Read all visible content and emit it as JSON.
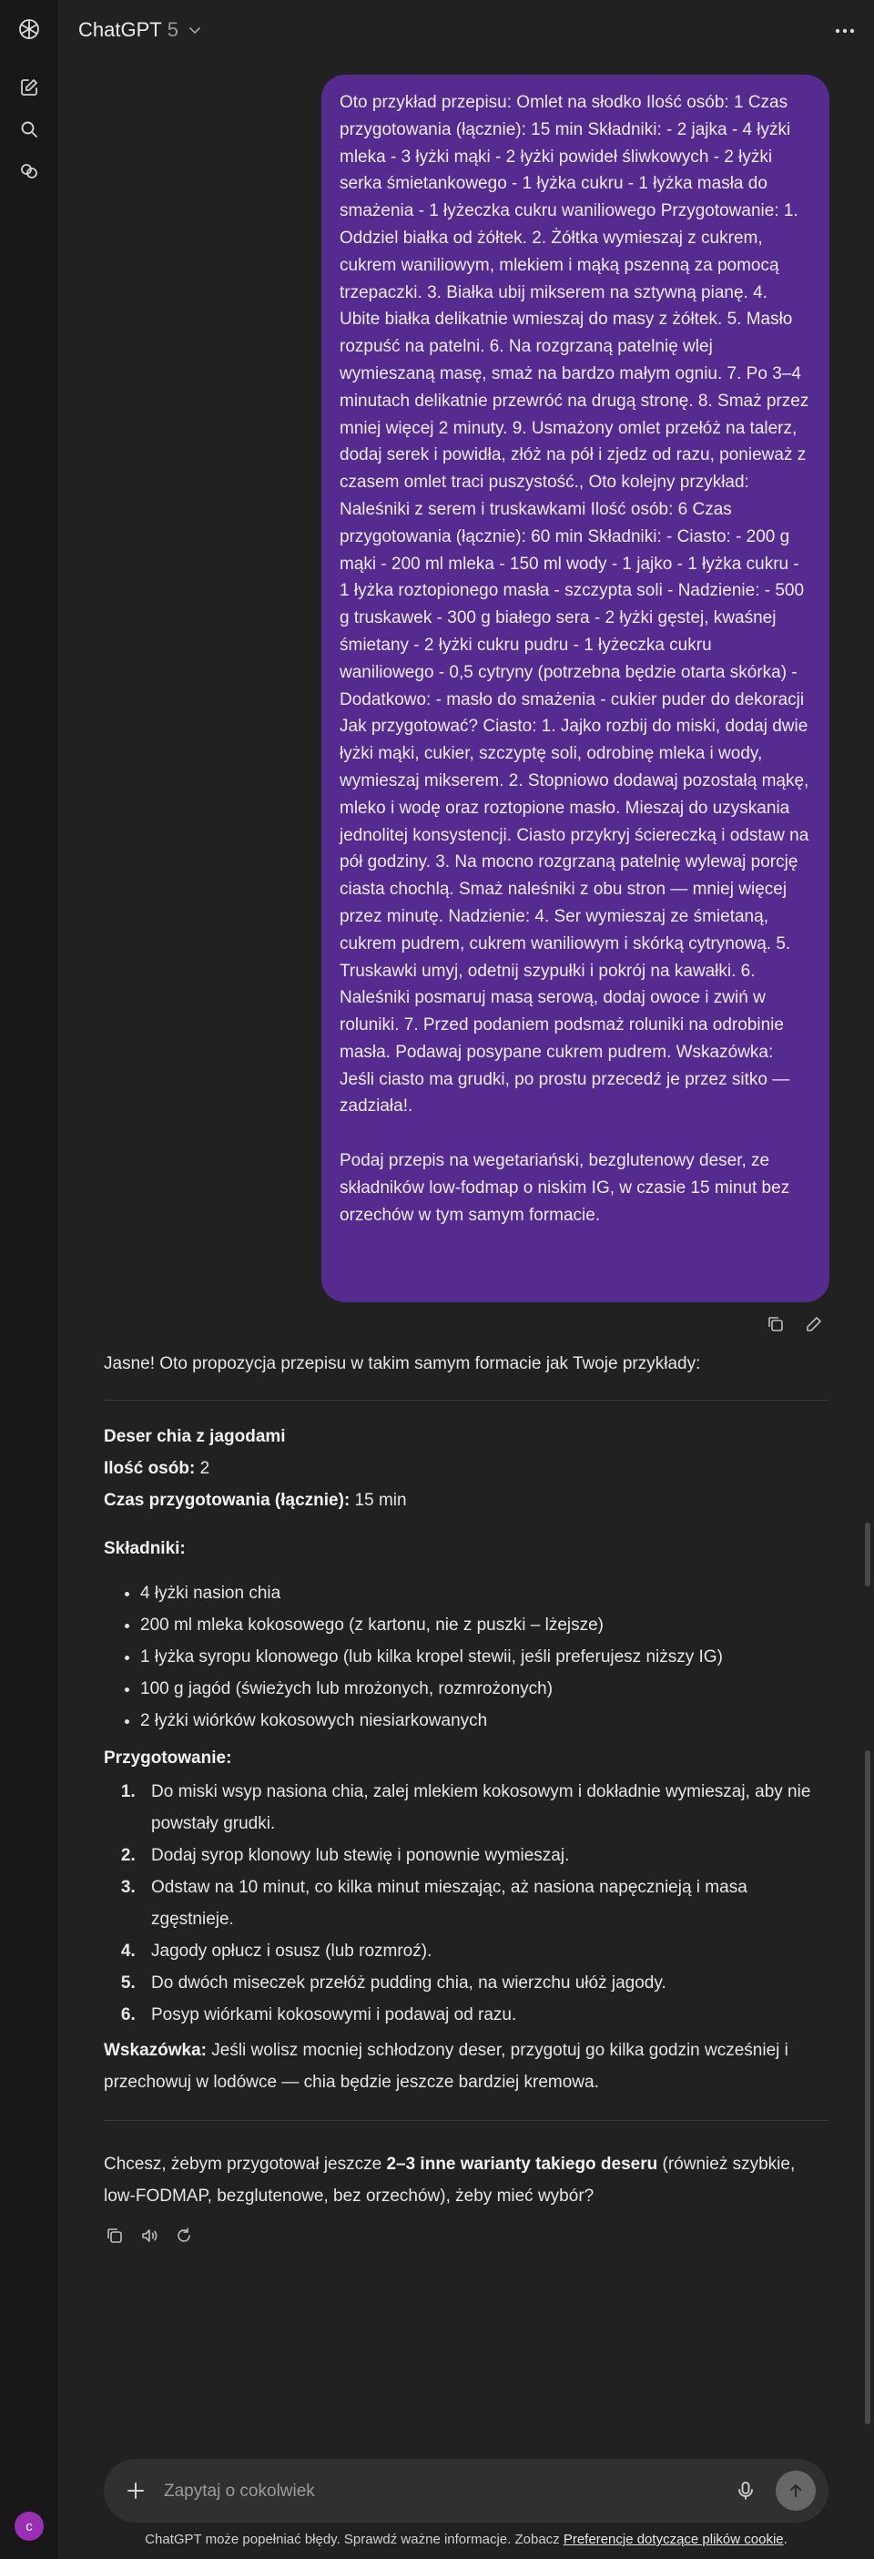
{
  "header": {
    "model_name": "ChatGPT",
    "model_version": "5"
  },
  "user_message": "Oto przykład przepisu: Omlet na słodko Ilość osób: 1 Czas przygotowania (łącznie): 15 min Składniki: - 2 jajka - 4 łyżki mleka - 3 łyżki mąki - 2 łyżki powideł śliwkowych - 2 łyżki serka śmietankowego - 1 łyżka cukru - 1 łyżka masła do smażenia - 1 łyżeczka cukru waniliowego Przygotowanie: 1. Oddziel białka od żółtek. 2. Żółtka wymieszaj z cukrem, cukrem waniliowym, mlekiem i mąką pszenną za pomocą trzepaczki. 3. Białka ubij mikserem na sztywną pianę. 4. Ubite białka delikatnie wmieszaj do masy z żółtek. 5. Masło rozpuść na patelni. 6. Na rozgrzaną patelnię wlej wymieszaną masę, smaż na bardzo małym ogniu. 7. Po 3–4 minutach delikatnie przewróć na drugą stronę. 8. Smaż przez mniej więcej 2 minuty. 9. Usmażony omlet przełóż na talerz, dodaj serek i powidła, złóż na pół i zjedz od razu, ponieważ z czasem omlet traci puszystość., Oto kolejny przykład: Naleśniki z serem i truskawkami Ilość osób: 6 Czas przygotowania (łącznie): 60 min Składniki: - Ciasto: - 200 g mąki - 200 ml mleka - 150 ml wody - 1 jajko - 1 łyżka cukru - 1 łyżka roztopionego masła - szczypta soli - Nadzienie: - 500 g truskawek - 300 g białego sera - 2 łyżki gęstej, kwaśnej śmietany - 2 łyżki cukru pudru - 1 łyżeczka cukru waniliowego - 0,5 cytryny (potrzebna będzie otarta skórka) - Dodatkowo: - masło do smażenia - cukier puder do dekoracji Jak przygotować? Ciasto: 1. Jajko rozbij do miski, dodaj dwie łyżki mąki, cukier, szczyptę soli, odrobinę mleka i wody, wymieszaj mikserem. 2. Stopniowo dodawaj pozostałą mąkę, mleko i wodę oraz roztopione masło. Mieszaj do uzyskania jednolitej konsystencji. Ciasto przykryj ściereczką i odstaw na pół godziny. 3. Na mocno rozgrzaną patelnię wylewaj porcję ciasta chochlą. Smaż naleśniki z obu stron — mniej więcej przez minutę. Nadzienie: 4. Ser wymieszaj ze śmietaną, cukrem pudrem, cukrem waniliowym i skórką cytrynową. 5. Truskawki umyj, odetnij szypułki i pokrój na kawałki. 6. Naleśniki posmaruj masą serową, dodaj owoce i zwiń w roluniki. 7. Przed podaniem podsmaż roluniki na odrobinie masła. Podawaj posypane cukrem pudrem. Wskazówka: Jeśli ciasto ma grudki, po prostu przecedź je przez sitko — zadziała!.\n\nPodaj przepis na wegetariański, bezglutenowy deser, ze składników low-fodmap o niskim IG, w czasie 15 minut bez orzechów w tym samym formacie.",
  "assistant": {
    "intro": "Jasne! Oto propozycja przepisu w takim samym formacie jak Twoje przykłady:",
    "title": "Deser chia z jagodami",
    "servings_label": "Ilość osób:",
    "servings_value": " 2",
    "time_label": "Czas przygotowania (łącznie):",
    "time_value": " 15 min",
    "ingredients_heading": "Składniki:",
    "ingredients": [
      "4 łyżki nasion chia",
      "200 ml mleka kokosowego (z kartonu, nie z puszki – lżejsze)",
      "1 łyżka syropu klonowego (lub kilka kropel stewii, jeśli preferujesz niższy IG)",
      "100 g jagód (świeżych lub mrożonych, rozmrożonych)",
      "2 łyżki wiórków kokosowych niesiarkowanych"
    ],
    "steps_heading": "Przygotowanie:",
    "steps": [
      "Do miski wsyp nasiona chia, zalej mlekiem kokosowym i dokładnie wymieszaj, aby nie powstały grudki.",
      "Dodaj syrop klonowy lub stewię i ponownie wymieszaj.",
      "Odstaw na 10 minut, co kilka minut mieszając, aż nasiona napęcznieją i masa zgęstnieje.",
      "Jagody opłucz i osusz (lub rozmroź).",
      "Do dwóch miseczek przełóż pudding chia, na wierzchu ułóż jagody.",
      "Posyp wiórkami kokosowymi i podawaj od razu."
    ],
    "tip_label": "Wskazówka:",
    "tip_text": " Jeśli wolisz mocniej schłodzony deser, przygotuj go kilka godzin wcześniej i przechowuj w lodówce — chia będzie jeszcze bardziej kremowa.",
    "followup_pre": "Chcesz, żebym przygotował jeszcze ",
    "followup_bold": "2–3 inne warianty takiego deseru",
    "followup_post": " (również szybkie, low-FODMAP, bezglutenowe, bez orzechów), żeby mieć wybór?"
  },
  "composer": {
    "placeholder": "Zapytaj o cokolwiek"
  },
  "footer": {
    "text": "ChatGPT może popełniać błędy. Sprawdź ważne informacje. Zobacz ",
    "link": "Preferencje dotyczące plików cookie",
    "end": "."
  },
  "user": {
    "avatar_initial": "c"
  },
  "colors": {
    "background": "#212121",
    "sidebar": "#181818",
    "user_bubble": "#552b8f",
    "composer": "#303030",
    "avatar": "#9b2fb3"
  },
  "icons": [
    "openai-logo-icon",
    "new-chat-icon",
    "search-icon",
    "library-icon",
    "chevron-down-icon",
    "more-dots-icon",
    "copy-icon",
    "edit-icon",
    "speaker-icon",
    "regenerate-icon",
    "plus-icon",
    "mic-icon",
    "send-arrow-icon"
  ]
}
